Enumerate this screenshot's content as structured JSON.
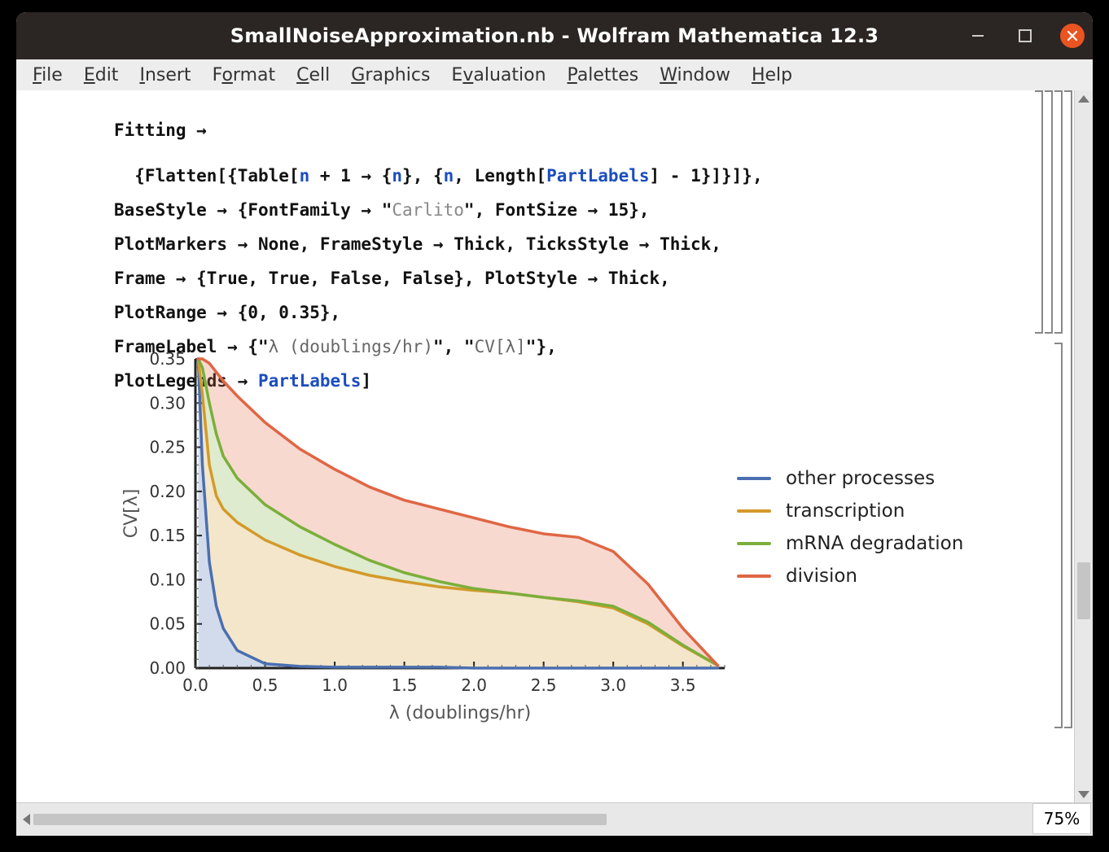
{
  "window": {
    "title": "SmallNoiseApproximation.nb - Wolfram Mathematica 12.3"
  },
  "menu": {
    "file": "File",
    "edit": "Edit",
    "insert": "Insert",
    "format": "Format",
    "cell": "Cell",
    "graphics": "Graphics",
    "evaluation": "Evaluation",
    "palettes": "Palettes",
    "window": "Window",
    "help": "Help"
  },
  "zoom": "75%",
  "code": {
    "line0a": "Fitting →",
    "line1_pre": "  {Flatten[{Table[",
    "line1_n1": "n",
    "line1_mid1": " + 1 → {",
    "line1_n2": "n",
    "line1_mid2": "}, {",
    "line1_n3": "n",
    "line1_mid3": ", Length[",
    "line1_partlabels": "PartLabels",
    "line1_post": "] - 1}]}]},",
    "line2_pre": "BaseStyle → {FontFamily → ",
    "line2_q1": "\"",
    "line2_str": "Carlito",
    "line2_q2": "\"",
    "line2_post": ", FontSize → 15},",
    "line3": "PlotMarkers → None, FrameStyle → Thick, TicksStyle → Thick,",
    "line4": "Frame → {True, True, False, False}, PlotStyle → Thick,",
    "line5": "PlotRange → {0, 0.35},",
    "line6_pre": "FrameLabel → {",
    "line6_q1": "\"",
    "line6_str1": "λ (doublings/hr)",
    "line6_q2": "\"",
    "line6_mid": ", ",
    "line6_q3": "\"",
    "line6_str2": "CV[λ]",
    "line6_q4": "\"",
    "line6_post": "},",
    "line7_pre": "PlotLegends → ",
    "line7_partlabels": "PartLabels",
    "line7_post": "]"
  },
  "chart_data": {
    "type": "area",
    "title": "",
    "xlabel": "λ (doublings/hr)",
    "ylabel": "CV[λ]",
    "xlim": [
      0.0,
      3.8
    ],
    "ylim": [
      0.0,
      0.35
    ],
    "x_ticks": [
      0.0,
      0.5,
      1.0,
      1.5,
      2.0,
      2.5,
      3.0,
      3.5
    ],
    "y_ticks": [
      0.0,
      0.05,
      0.1,
      0.15,
      0.2,
      0.25,
      0.3,
      0.35
    ],
    "x": [
      0.02,
      0.05,
      0.1,
      0.15,
      0.2,
      0.3,
      0.5,
      0.75,
      1.0,
      1.25,
      1.5,
      1.75,
      2.0,
      2.25,
      2.5,
      2.75,
      3.0,
      3.25,
      3.5,
      3.75
    ],
    "series": [
      {
        "name": "other processes",
        "color": "#4a6fb0",
        "values": [
          0.35,
          0.23,
          0.12,
          0.07,
          0.045,
          0.02,
          0.005,
          0.002,
          0.001,
          0.001,
          0.001,
          0.001,
          0.0,
          0.0,
          0.0,
          0.0,
          0.0,
          0.0,
          0.0,
          0.0
        ]
      },
      {
        "name": "transcription",
        "color": "#d39a2a",
        "values": [
          0.35,
          0.31,
          0.23,
          0.195,
          0.18,
          0.165,
          0.145,
          0.128,
          0.115,
          0.105,
          0.098,
          0.092,
          0.088,
          0.085,
          0.08,
          0.075,
          0.068,
          0.05,
          0.025,
          0.003
        ]
      },
      {
        "name": "mRNA degradation",
        "color": "#7cae3b",
        "values": [
          0.35,
          0.34,
          0.3,
          0.265,
          0.24,
          0.215,
          0.185,
          0.16,
          0.14,
          0.122,
          0.108,
          0.098,
          0.09,
          0.085,
          0.08,
          0.076,
          0.07,
          0.052,
          0.026,
          0.003
        ]
      },
      {
        "name": "division",
        "color": "#e06644",
        "values": [
          0.35,
          0.35,
          0.345,
          0.335,
          0.325,
          0.308,
          0.278,
          0.248,
          0.225,
          0.205,
          0.19,
          0.18,
          0.17,
          0.16,
          0.152,
          0.148,
          0.132,
          0.095,
          0.045,
          0.003
        ]
      }
    ],
    "legend": [
      "other processes",
      "transcription",
      "mRNA degradation",
      "division"
    ]
  },
  "legend_colors": {
    "other": "#4a6fb0",
    "transcription": "#d39a2a",
    "mrna": "#7cae3b",
    "division": "#e06644"
  }
}
